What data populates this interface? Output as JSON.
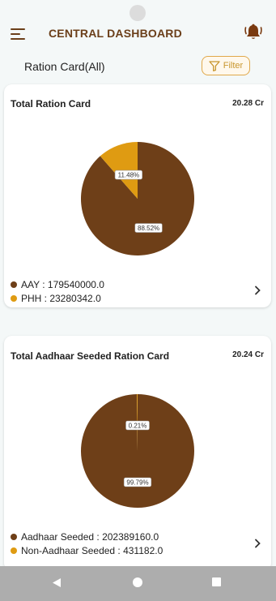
{
  "header": {
    "title": "CENTRAL DASHBOARD",
    "menu_icon": "hamburger-menu-icon",
    "notification_icon": "bell-icon"
  },
  "section": {
    "title": "Ration Card(All)",
    "filter_label": "Filter",
    "filter_icon": "funnel-icon"
  },
  "colors": {
    "primary_brown": "#6b3f1a",
    "accent_amber": "#df9b12",
    "background": "#f4f8f8"
  },
  "cards": [
    {
      "title": "Total Ration Card",
      "total": "20.28 Cr",
      "legend": [
        {
          "label": "AAY : 179540000.0",
          "color": "#6e3f18"
        },
        {
          "label": "PHH : 23280342.0",
          "color": "#df9b12"
        }
      ]
    },
    {
      "title": "Total Aadhaar Seeded Ration Card",
      "total": "20.24 Cr",
      "legend": [
        {
          "label": "Aadhaar Seeded : 202389160.0",
          "color": "#6e3f18"
        },
        {
          "label": "Non-Aadhaar Seeded : 431182.0",
          "color": "#df9b12"
        }
      ]
    }
  ],
  "chart_data": [
    {
      "type": "pie",
      "title": "Total Ration Card",
      "categories": [
        "AAY",
        "PHH"
      ],
      "values": [
        179540000.0,
        23280342.0
      ],
      "labels": [
        "88.52%",
        "11.48%"
      ],
      "colors": [
        "#6e3f18",
        "#df9b12"
      ]
    },
    {
      "type": "pie",
      "title": "Total Aadhaar Seeded Ration Card",
      "categories": [
        "Aadhaar Seeded",
        "Non-Aadhaar Seeded"
      ],
      "values": [
        202389160.0,
        431182.0
      ],
      "labels": [
        "99.79%",
        "0.21%"
      ],
      "colors": [
        "#6e3f18",
        "#df9b12"
      ]
    }
  ],
  "navigation": {
    "back_icon": "back-triangle-icon",
    "home_icon": "home-circle-icon",
    "recents_icon": "recents-square-icon"
  }
}
